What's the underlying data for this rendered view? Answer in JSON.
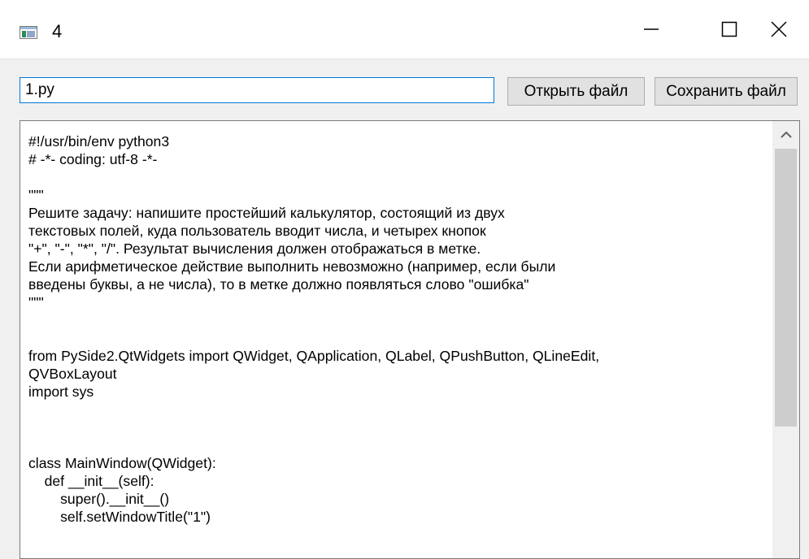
{
  "window": {
    "title": "4",
    "icon": "app-window-icon",
    "controls": [
      "minimize-icon",
      "maximize-icon",
      "close-icon"
    ]
  },
  "toolbar": {
    "filename_value": "1.py",
    "open_label": "Открыть файл",
    "save_label": "Сохранить файл"
  },
  "editor": {
    "lines": [
      "#!/usr/bin/env python3",
      "# -*- coding: utf-8 -*-",
      "",
      "\"\"\"",
      "Решите задачу: напишите простейший калькулятор, состоящий из двух",
      "текстовых полей, куда пользователь вводит числа, и четырех кнопок",
      "\"+\", \"-\", \"*\", \"/\". Результат вычисления должен отображаться в метке.",
      "Если арифметическое действие выполнить невозможно (например, если были",
      "введены буквы, а не числа), то в метке должно появляться слово \"ошибка\"",
      "\"\"\"",
      "",
      "",
      "from PySide2.QtWidgets import QWidget, QApplication, QLabel, QPushButton, QLineEdit,",
      "QVBoxLayout",
      "import sys",
      "",
      "",
      "",
      "class MainWindow(QWidget):",
      "    def __init__(self):",
      "        super().__init__()",
      "        self.setWindowTitle(\"1\")"
    ]
  },
  "scrollbar": {
    "position_fraction": 0.0,
    "visible_fraction": 0.66
  }
}
